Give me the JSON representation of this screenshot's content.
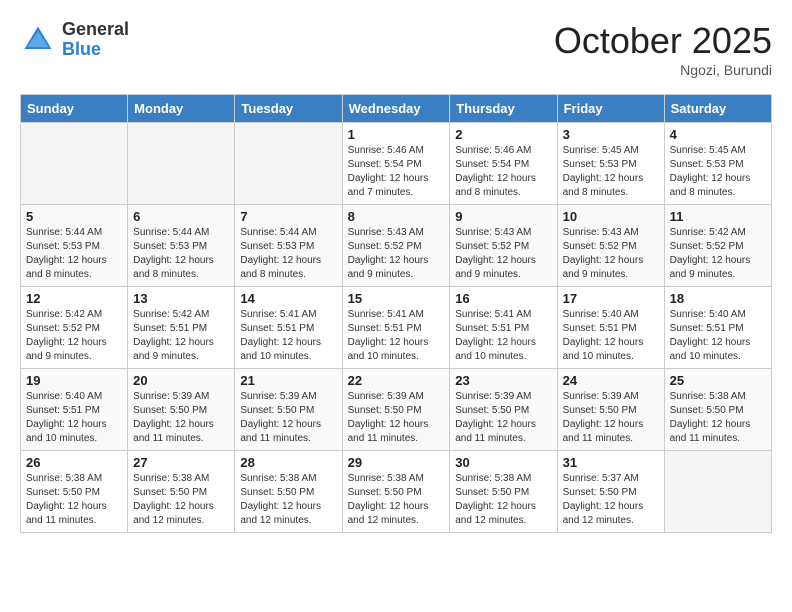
{
  "header": {
    "logo_general": "General",
    "logo_blue": "Blue",
    "month_title": "October 2025",
    "location": "Ngozi, Burundi"
  },
  "weekdays": [
    "Sunday",
    "Monday",
    "Tuesday",
    "Wednesday",
    "Thursday",
    "Friday",
    "Saturday"
  ],
  "weeks": [
    [
      {
        "day": "",
        "info": ""
      },
      {
        "day": "",
        "info": ""
      },
      {
        "day": "",
        "info": ""
      },
      {
        "day": "1",
        "info": "Sunrise: 5:46 AM\nSunset: 5:54 PM\nDaylight: 12 hours\nand 7 minutes."
      },
      {
        "day": "2",
        "info": "Sunrise: 5:46 AM\nSunset: 5:54 PM\nDaylight: 12 hours\nand 8 minutes."
      },
      {
        "day": "3",
        "info": "Sunrise: 5:45 AM\nSunset: 5:53 PM\nDaylight: 12 hours\nand 8 minutes."
      },
      {
        "day": "4",
        "info": "Sunrise: 5:45 AM\nSunset: 5:53 PM\nDaylight: 12 hours\nand 8 minutes."
      }
    ],
    [
      {
        "day": "5",
        "info": "Sunrise: 5:44 AM\nSunset: 5:53 PM\nDaylight: 12 hours\nand 8 minutes."
      },
      {
        "day": "6",
        "info": "Sunrise: 5:44 AM\nSunset: 5:53 PM\nDaylight: 12 hours\nand 8 minutes."
      },
      {
        "day": "7",
        "info": "Sunrise: 5:44 AM\nSunset: 5:53 PM\nDaylight: 12 hours\nand 8 minutes."
      },
      {
        "day": "8",
        "info": "Sunrise: 5:43 AM\nSunset: 5:52 PM\nDaylight: 12 hours\nand 9 minutes."
      },
      {
        "day": "9",
        "info": "Sunrise: 5:43 AM\nSunset: 5:52 PM\nDaylight: 12 hours\nand 9 minutes."
      },
      {
        "day": "10",
        "info": "Sunrise: 5:43 AM\nSunset: 5:52 PM\nDaylight: 12 hours\nand 9 minutes."
      },
      {
        "day": "11",
        "info": "Sunrise: 5:42 AM\nSunset: 5:52 PM\nDaylight: 12 hours\nand 9 minutes."
      }
    ],
    [
      {
        "day": "12",
        "info": "Sunrise: 5:42 AM\nSunset: 5:52 PM\nDaylight: 12 hours\nand 9 minutes."
      },
      {
        "day": "13",
        "info": "Sunrise: 5:42 AM\nSunset: 5:51 PM\nDaylight: 12 hours\nand 9 minutes."
      },
      {
        "day": "14",
        "info": "Sunrise: 5:41 AM\nSunset: 5:51 PM\nDaylight: 12 hours\nand 10 minutes."
      },
      {
        "day": "15",
        "info": "Sunrise: 5:41 AM\nSunset: 5:51 PM\nDaylight: 12 hours\nand 10 minutes."
      },
      {
        "day": "16",
        "info": "Sunrise: 5:41 AM\nSunset: 5:51 PM\nDaylight: 12 hours\nand 10 minutes."
      },
      {
        "day": "17",
        "info": "Sunrise: 5:40 AM\nSunset: 5:51 PM\nDaylight: 12 hours\nand 10 minutes."
      },
      {
        "day": "18",
        "info": "Sunrise: 5:40 AM\nSunset: 5:51 PM\nDaylight: 12 hours\nand 10 minutes."
      }
    ],
    [
      {
        "day": "19",
        "info": "Sunrise: 5:40 AM\nSunset: 5:51 PM\nDaylight: 12 hours\nand 10 minutes."
      },
      {
        "day": "20",
        "info": "Sunrise: 5:39 AM\nSunset: 5:50 PM\nDaylight: 12 hours\nand 11 minutes."
      },
      {
        "day": "21",
        "info": "Sunrise: 5:39 AM\nSunset: 5:50 PM\nDaylight: 12 hours\nand 11 minutes."
      },
      {
        "day": "22",
        "info": "Sunrise: 5:39 AM\nSunset: 5:50 PM\nDaylight: 12 hours\nand 11 minutes."
      },
      {
        "day": "23",
        "info": "Sunrise: 5:39 AM\nSunset: 5:50 PM\nDaylight: 12 hours\nand 11 minutes."
      },
      {
        "day": "24",
        "info": "Sunrise: 5:39 AM\nSunset: 5:50 PM\nDaylight: 12 hours\nand 11 minutes."
      },
      {
        "day": "25",
        "info": "Sunrise: 5:38 AM\nSunset: 5:50 PM\nDaylight: 12 hours\nand 11 minutes."
      }
    ],
    [
      {
        "day": "26",
        "info": "Sunrise: 5:38 AM\nSunset: 5:50 PM\nDaylight: 12 hours\nand 11 minutes."
      },
      {
        "day": "27",
        "info": "Sunrise: 5:38 AM\nSunset: 5:50 PM\nDaylight: 12 hours\nand 12 minutes."
      },
      {
        "day": "28",
        "info": "Sunrise: 5:38 AM\nSunset: 5:50 PM\nDaylight: 12 hours\nand 12 minutes."
      },
      {
        "day": "29",
        "info": "Sunrise: 5:38 AM\nSunset: 5:50 PM\nDaylight: 12 hours\nand 12 minutes."
      },
      {
        "day": "30",
        "info": "Sunrise: 5:38 AM\nSunset: 5:50 PM\nDaylight: 12 hours\nand 12 minutes."
      },
      {
        "day": "31",
        "info": "Sunrise: 5:37 AM\nSunset: 5:50 PM\nDaylight: 12 hours\nand 12 minutes."
      },
      {
        "day": "",
        "info": ""
      }
    ]
  ]
}
